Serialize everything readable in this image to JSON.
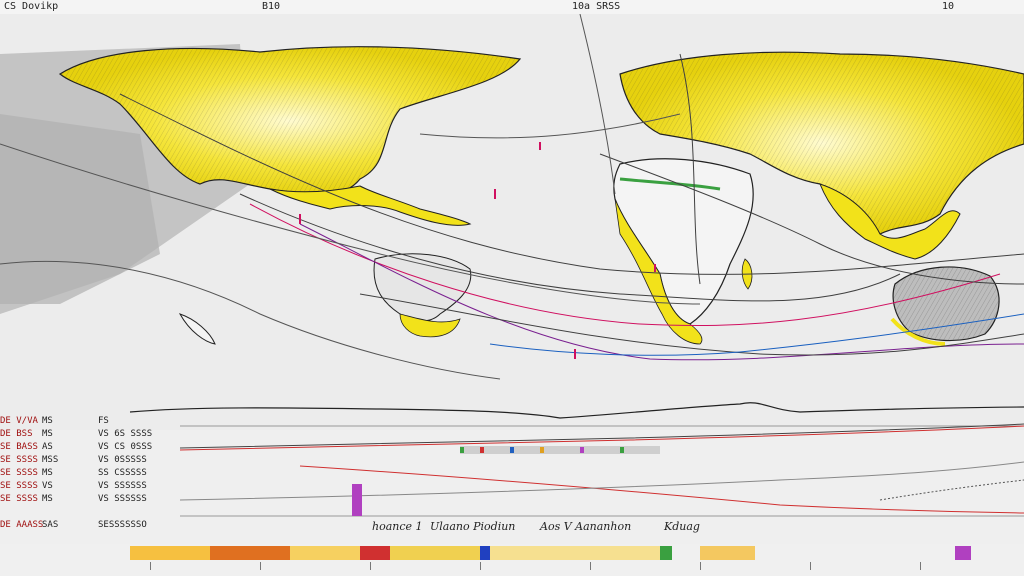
{
  "topbar": {
    "left_label": "CS Dovikp",
    "mid_label": "B10",
    "right_label": "10a SRSS",
    "num_label": "10"
  },
  "map": {
    "land_color": "#f2e21a",
    "land_shade": "#f9f4a0",
    "ocean_color": "#e8e8e8",
    "route_colors": [
      "#d01060",
      "#404040",
      "#7a2090",
      "#1a60c0"
    ]
  },
  "legend_table": {
    "rows": [
      [
        "DE V/VA",
        "MS",
        "FS"
      ],
      [
        "DE BSS",
        "MS",
        "VS 6S SSSS"
      ],
      [
        "SE BASS",
        "AS",
        "VS CS 0SSS"
      ],
      [
        "SE SSSS",
        "MSS",
        "VS 0SSSSS"
      ],
      [
        "SE SSSS",
        "MS",
        "SS CSSSSS"
      ],
      [
        "SE SSSS",
        "VS",
        "VS SSSSSS"
      ],
      [
        "SE SSSS",
        "MS",
        "VS SSSSSS"
      ],
      [
        "DE AAASS",
        "SAS",
        "SESSSSSSO"
      ]
    ]
  },
  "profile": {
    "bar_colors": [
      "#b040c0",
      "#2060c0",
      "#3aa040",
      "#e0a020",
      "#d03030"
    ]
  },
  "bottom_labels": {
    "l1": "hoance 1",
    "l2": "Ulaano Piodiun",
    "l3": "Aos V Aananhon",
    "l4": "Kduag"
  },
  "bottom_strip_colors": [
    "#f6c040",
    "#e07020",
    "#d03030",
    "#3aa040",
    "#b040c0",
    "#2040c0",
    "#f0d050"
  ]
}
